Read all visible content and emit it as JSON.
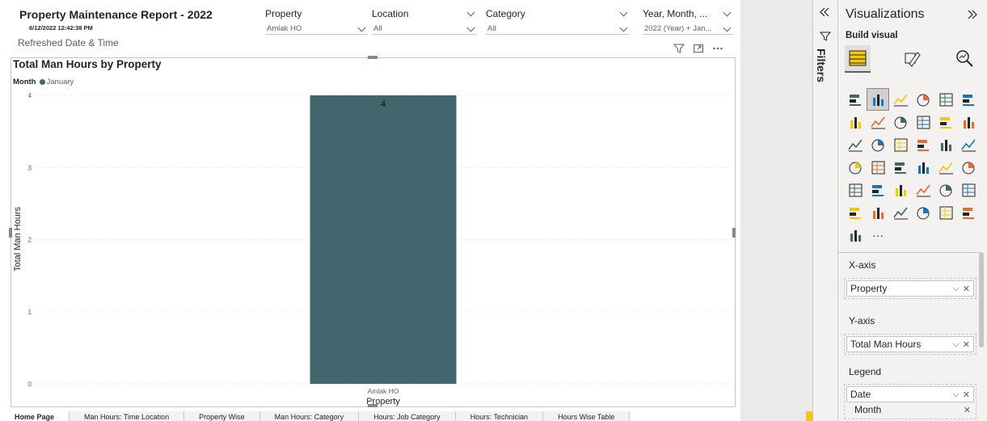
{
  "report": {
    "title": "Property Maintenance Report - 2022",
    "refresh_date": "6/12/2022 12:42:38 PM",
    "refresh_label": "Refreshed Date & Time"
  },
  "slicers": [
    {
      "label": "Property",
      "value": "Amlak HO"
    },
    {
      "label": "Location",
      "value": "All"
    },
    {
      "label": "Category",
      "value": "All"
    },
    {
      "label": "Year, Month, ...",
      "value": "2022 (Year) + Jan..."
    }
  ],
  "visual": {
    "title": "Total Man Hours by Property",
    "legend_title": "Month",
    "legend_item": "January",
    "icons": [
      "filter-icon",
      "focus-mode-icon",
      "more-options-icon"
    ]
  },
  "chart_data": {
    "type": "bar",
    "categories": [
      "Amlak HO"
    ],
    "series": [
      {
        "name": "January",
        "values": [
          4
        ]
      }
    ],
    "data_labels": [
      "4"
    ],
    "xlabel": "Property",
    "ylabel": "Total Man Hours",
    "ylim": [
      0,
      4
    ],
    "yticks": [
      "0",
      "1",
      "2",
      "3",
      "4"
    ],
    "grid": true,
    "legend_placement": "top-left",
    "bar_color": "#41666e"
  },
  "tabs": [
    "Home Page",
    "Man Hours: Time Location",
    "Property Wise",
    "Man Hours: Category",
    "Hours: Job Category",
    "Hours: Technician",
    "Hours Wise Table"
  ],
  "filters_pane": {
    "label": "Filters"
  },
  "viz_pane": {
    "title": "Visualizations",
    "build_label": "Build visual",
    "more_label": "···",
    "x_axis": {
      "label": "X-axis",
      "field": "Property"
    },
    "y_axis": {
      "label": "Y-axis",
      "field": "Total Man Hours"
    },
    "legend": {
      "label": "Legend",
      "field": "Date",
      "sub_field": "Month"
    }
  },
  "colors": {
    "accent": "#41666e",
    "highlight": "#f2c811"
  }
}
